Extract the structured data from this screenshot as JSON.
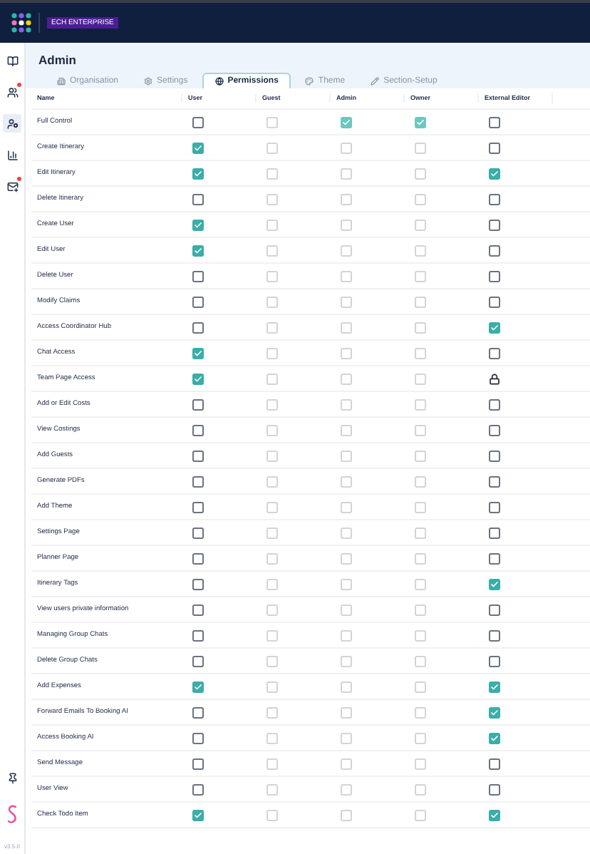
{
  "header": {
    "badge": "ECH ENTERPRISE"
  },
  "sidebar": {
    "items": [
      {
        "kind": "book",
        "badge": false,
        "selected": false
      },
      {
        "kind": "users",
        "badge": true,
        "selected": false
      },
      {
        "kind": "user-cog",
        "badge": false,
        "selected": true
      },
      {
        "kind": "chart",
        "badge": false,
        "selected": false
      },
      {
        "kind": "mail",
        "badge": true,
        "selected": false
      }
    ],
    "version": "v3.5.0"
  },
  "page": {
    "title": "Admin"
  },
  "tabs": [
    {
      "label": "Organisation",
      "selected": false
    },
    {
      "label": "Settings",
      "selected": false
    },
    {
      "label": "Permissions",
      "selected": true
    },
    {
      "label": "Theme",
      "selected": false
    },
    {
      "label": "Section-Setup",
      "selected": false
    }
  ],
  "table": {
    "columns": [
      "Name",
      "User",
      "Guest",
      "Admin",
      "Owner",
      "External Editor"
    ],
    "rows": [
      {
        "name": "Full Control",
        "cells": [
          {
            "kind": "checkbox",
            "checked": false,
            "disabled": false
          },
          {
            "kind": "checkbox",
            "checked": false,
            "disabled": true
          },
          {
            "kind": "checkbox",
            "checked": true,
            "disabled": true
          },
          {
            "kind": "checkbox",
            "checked": true,
            "disabled": true
          },
          {
            "kind": "checkbox",
            "checked": false,
            "disabled": false
          }
        ]
      },
      {
        "name": "Create Itinerary",
        "cells": [
          {
            "kind": "checkbox",
            "checked": true,
            "disabled": false
          },
          {
            "kind": "checkbox",
            "checked": false,
            "disabled": true
          },
          {
            "kind": "checkbox",
            "checked": false,
            "disabled": true
          },
          {
            "kind": "checkbox",
            "checked": false,
            "disabled": true
          },
          {
            "kind": "checkbox",
            "checked": false,
            "disabled": false
          }
        ]
      },
      {
        "name": "Edit Itinerary",
        "cells": [
          {
            "kind": "checkbox",
            "checked": true,
            "disabled": false
          },
          {
            "kind": "checkbox",
            "checked": false,
            "disabled": true
          },
          {
            "kind": "checkbox",
            "checked": false,
            "disabled": true
          },
          {
            "kind": "checkbox",
            "checked": false,
            "disabled": true
          },
          {
            "kind": "checkbox",
            "checked": true,
            "disabled": false
          }
        ]
      },
      {
        "name": "Delete Itinerary",
        "cells": [
          {
            "kind": "checkbox",
            "checked": false,
            "disabled": false
          },
          {
            "kind": "checkbox",
            "checked": false,
            "disabled": true
          },
          {
            "kind": "checkbox",
            "checked": false,
            "disabled": true
          },
          {
            "kind": "checkbox",
            "checked": false,
            "disabled": true
          },
          {
            "kind": "checkbox",
            "checked": false,
            "disabled": false
          }
        ]
      },
      {
        "name": "Create User",
        "cells": [
          {
            "kind": "checkbox",
            "checked": true,
            "disabled": false
          },
          {
            "kind": "checkbox",
            "checked": false,
            "disabled": true
          },
          {
            "kind": "checkbox",
            "checked": false,
            "disabled": true
          },
          {
            "kind": "checkbox",
            "checked": false,
            "disabled": true
          },
          {
            "kind": "checkbox",
            "checked": false,
            "disabled": false
          }
        ]
      },
      {
        "name": "Edit User",
        "cells": [
          {
            "kind": "checkbox",
            "checked": true,
            "disabled": false
          },
          {
            "kind": "checkbox",
            "checked": false,
            "disabled": true
          },
          {
            "kind": "checkbox",
            "checked": false,
            "disabled": true
          },
          {
            "kind": "checkbox",
            "checked": false,
            "disabled": true
          },
          {
            "kind": "checkbox",
            "checked": false,
            "disabled": false
          }
        ]
      },
      {
        "name": "Delete User",
        "cells": [
          {
            "kind": "checkbox",
            "checked": false,
            "disabled": false
          },
          {
            "kind": "checkbox",
            "checked": false,
            "disabled": true
          },
          {
            "kind": "checkbox",
            "checked": false,
            "disabled": true
          },
          {
            "kind": "checkbox",
            "checked": false,
            "disabled": true
          },
          {
            "kind": "checkbox",
            "checked": false,
            "disabled": false
          }
        ]
      },
      {
        "name": "Modify Claims",
        "cells": [
          {
            "kind": "checkbox",
            "checked": false,
            "disabled": false
          },
          {
            "kind": "checkbox",
            "checked": false,
            "disabled": true
          },
          {
            "kind": "checkbox",
            "checked": false,
            "disabled": true
          },
          {
            "kind": "checkbox",
            "checked": false,
            "disabled": true
          },
          {
            "kind": "checkbox",
            "checked": false,
            "disabled": false
          }
        ]
      },
      {
        "name": "Access Coordinator Hub",
        "cells": [
          {
            "kind": "checkbox",
            "checked": false,
            "disabled": false
          },
          {
            "kind": "checkbox",
            "checked": false,
            "disabled": true
          },
          {
            "kind": "checkbox",
            "checked": false,
            "disabled": true
          },
          {
            "kind": "checkbox",
            "checked": false,
            "disabled": true
          },
          {
            "kind": "checkbox",
            "checked": true,
            "disabled": false
          }
        ]
      },
      {
        "name": "Chat Access",
        "cells": [
          {
            "kind": "checkbox",
            "checked": true,
            "disabled": false
          },
          {
            "kind": "checkbox",
            "checked": false,
            "disabled": true
          },
          {
            "kind": "checkbox",
            "checked": false,
            "disabled": true
          },
          {
            "kind": "checkbox",
            "checked": false,
            "disabled": true
          },
          {
            "kind": "checkbox",
            "checked": false,
            "disabled": false
          }
        ]
      },
      {
        "name": "Team Page Access",
        "cells": [
          {
            "kind": "checkbox",
            "checked": true,
            "disabled": false
          },
          {
            "kind": "checkbox",
            "checked": false,
            "disabled": true
          },
          {
            "kind": "checkbox",
            "checked": false,
            "disabled": true
          },
          {
            "kind": "checkbox",
            "checked": false,
            "disabled": true
          },
          {
            "kind": "lock"
          }
        ]
      },
      {
        "name": "Add or Edit Costs",
        "cells": [
          {
            "kind": "checkbox",
            "checked": false,
            "disabled": false
          },
          {
            "kind": "checkbox",
            "checked": false,
            "disabled": true
          },
          {
            "kind": "checkbox",
            "checked": false,
            "disabled": true
          },
          {
            "kind": "checkbox",
            "checked": false,
            "disabled": true
          },
          {
            "kind": "checkbox",
            "checked": false,
            "disabled": false
          }
        ]
      },
      {
        "name": "View Costings",
        "cells": [
          {
            "kind": "checkbox",
            "checked": false,
            "disabled": false
          },
          {
            "kind": "checkbox",
            "checked": false,
            "disabled": true
          },
          {
            "kind": "checkbox",
            "checked": false,
            "disabled": true
          },
          {
            "kind": "checkbox",
            "checked": false,
            "disabled": true
          },
          {
            "kind": "checkbox",
            "checked": false,
            "disabled": false
          }
        ]
      },
      {
        "name": "Add Guests",
        "cells": [
          {
            "kind": "checkbox",
            "checked": false,
            "disabled": false
          },
          {
            "kind": "checkbox",
            "checked": false,
            "disabled": true
          },
          {
            "kind": "checkbox",
            "checked": false,
            "disabled": true
          },
          {
            "kind": "checkbox",
            "checked": false,
            "disabled": true
          },
          {
            "kind": "checkbox",
            "checked": false,
            "disabled": false
          }
        ]
      },
      {
        "name": "Generate PDFs",
        "cells": [
          {
            "kind": "checkbox",
            "checked": false,
            "disabled": false
          },
          {
            "kind": "checkbox",
            "checked": false,
            "disabled": true
          },
          {
            "kind": "checkbox",
            "checked": false,
            "disabled": true
          },
          {
            "kind": "checkbox",
            "checked": false,
            "disabled": true
          },
          {
            "kind": "checkbox",
            "checked": false,
            "disabled": false
          }
        ]
      },
      {
        "name": "Add Theme",
        "cells": [
          {
            "kind": "checkbox",
            "checked": false,
            "disabled": false
          },
          {
            "kind": "checkbox",
            "checked": false,
            "disabled": true
          },
          {
            "kind": "checkbox",
            "checked": false,
            "disabled": true
          },
          {
            "kind": "checkbox",
            "checked": false,
            "disabled": true
          },
          {
            "kind": "checkbox",
            "checked": false,
            "disabled": false
          }
        ]
      },
      {
        "name": "Settings Page",
        "cells": [
          {
            "kind": "checkbox",
            "checked": false,
            "disabled": false
          },
          {
            "kind": "checkbox",
            "checked": false,
            "disabled": true
          },
          {
            "kind": "checkbox",
            "checked": false,
            "disabled": true
          },
          {
            "kind": "checkbox",
            "checked": false,
            "disabled": true
          },
          {
            "kind": "checkbox",
            "checked": false,
            "disabled": false
          }
        ]
      },
      {
        "name": "Planner Page",
        "cells": [
          {
            "kind": "checkbox",
            "checked": false,
            "disabled": false
          },
          {
            "kind": "checkbox",
            "checked": false,
            "disabled": true
          },
          {
            "kind": "checkbox",
            "checked": false,
            "disabled": true
          },
          {
            "kind": "checkbox",
            "checked": false,
            "disabled": true
          },
          {
            "kind": "checkbox",
            "checked": false,
            "disabled": false
          }
        ]
      },
      {
        "name": "Itinerary Tags",
        "cells": [
          {
            "kind": "checkbox",
            "checked": false,
            "disabled": false
          },
          {
            "kind": "checkbox",
            "checked": false,
            "disabled": true
          },
          {
            "kind": "checkbox",
            "checked": false,
            "disabled": true
          },
          {
            "kind": "checkbox",
            "checked": false,
            "disabled": true
          },
          {
            "kind": "checkbox",
            "checked": true,
            "disabled": false
          }
        ]
      },
      {
        "name": "View users private information",
        "cells": [
          {
            "kind": "checkbox",
            "checked": false,
            "disabled": false
          },
          {
            "kind": "checkbox",
            "checked": false,
            "disabled": true
          },
          {
            "kind": "checkbox",
            "checked": false,
            "disabled": true
          },
          {
            "kind": "checkbox",
            "checked": false,
            "disabled": true
          },
          {
            "kind": "checkbox",
            "checked": false,
            "disabled": false
          }
        ]
      },
      {
        "name": "Managing Group Chats",
        "cells": [
          {
            "kind": "checkbox",
            "checked": false,
            "disabled": false
          },
          {
            "kind": "checkbox",
            "checked": false,
            "disabled": true
          },
          {
            "kind": "checkbox",
            "checked": false,
            "disabled": true
          },
          {
            "kind": "checkbox",
            "checked": false,
            "disabled": true
          },
          {
            "kind": "checkbox",
            "checked": false,
            "disabled": false
          }
        ]
      },
      {
        "name": "Delete Group Chats",
        "cells": [
          {
            "kind": "checkbox",
            "checked": false,
            "disabled": false
          },
          {
            "kind": "checkbox",
            "checked": false,
            "disabled": true
          },
          {
            "kind": "checkbox",
            "checked": false,
            "disabled": true
          },
          {
            "kind": "checkbox",
            "checked": false,
            "disabled": true
          },
          {
            "kind": "checkbox",
            "checked": false,
            "disabled": false
          }
        ]
      },
      {
        "name": "Add Expenses",
        "cells": [
          {
            "kind": "checkbox",
            "checked": true,
            "disabled": false
          },
          {
            "kind": "checkbox",
            "checked": false,
            "disabled": true
          },
          {
            "kind": "checkbox",
            "checked": false,
            "disabled": true
          },
          {
            "kind": "checkbox",
            "checked": false,
            "disabled": true
          },
          {
            "kind": "checkbox",
            "checked": true,
            "disabled": false
          }
        ]
      },
      {
        "name": "Forward Emails To Booking AI",
        "cells": [
          {
            "kind": "checkbox",
            "checked": false,
            "disabled": false
          },
          {
            "kind": "checkbox",
            "checked": false,
            "disabled": true
          },
          {
            "kind": "checkbox",
            "checked": false,
            "disabled": true
          },
          {
            "kind": "checkbox",
            "checked": false,
            "disabled": true
          },
          {
            "kind": "checkbox",
            "checked": true,
            "disabled": false
          }
        ]
      },
      {
        "name": "Access Booking AI",
        "cells": [
          {
            "kind": "checkbox",
            "checked": false,
            "disabled": false
          },
          {
            "kind": "checkbox",
            "checked": false,
            "disabled": true
          },
          {
            "kind": "checkbox",
            "checked": false,
            "disabled": true
          },
          {
            "kind": "checkbox",
            "checked": false,
            "disabled": true
          },
          {
            "kind": "checkbox",
            "checked": true,
            "disabled": false
          }
        ]
      },
      {
        "name": "Send Message",
        "cells": [
          {
            "kind": "checkbox",
            "checked": false,
            "disabled": false
          },
          {
            "kind": "checkbox",
            "checked": false,
            "disabled": true
          },
          {
            "kind": "checkbox",
            "checked": false,
            "disabled": true
          },
          {
            "kind": "checkbox",
            "checked": false,
            "disabled": true
          },
          {
            "kind": "checkbox",
            "checked": false,
            "disabled": false
          }
        ]
      },
      {
        "name": "User View",
        "cells": [
          {
            "kind": "checkbox",
            "checked": false,
            "disabled": false
          },
          {
            "kind": "checkbox",
            "checked": false,
            "disabled": true
          },
          {
            "kind": "checkbox",
            "checked": false,
            "disabled": true
          },
          {
            "kind": "checkbox",
            "checked": false,
            "disabled": true
          },
          {
            "kind": "checkbox",
            "checked": false,
            "disabled": false
          }
        ]
      },
      {
        "name": "Check Todo Item",
        "cells": [
          {
            "kind": "checkbox",
            "checked": true,
            "disabled": false
          },
          {
            "kind": "checkbox",
            "checked": false,
            "disabled": true
          },
          {
            "kind": "checkbox",
            "checked": false,
            "disabled": true
          },
          {
            "kind": "checkbox",
            "checked": false,
            "disabled": true
          },
          {
            "kind": "checkbox",
            "checked": true,
            "disabled": false
          }
        ]
      }
    ]
  }
}
